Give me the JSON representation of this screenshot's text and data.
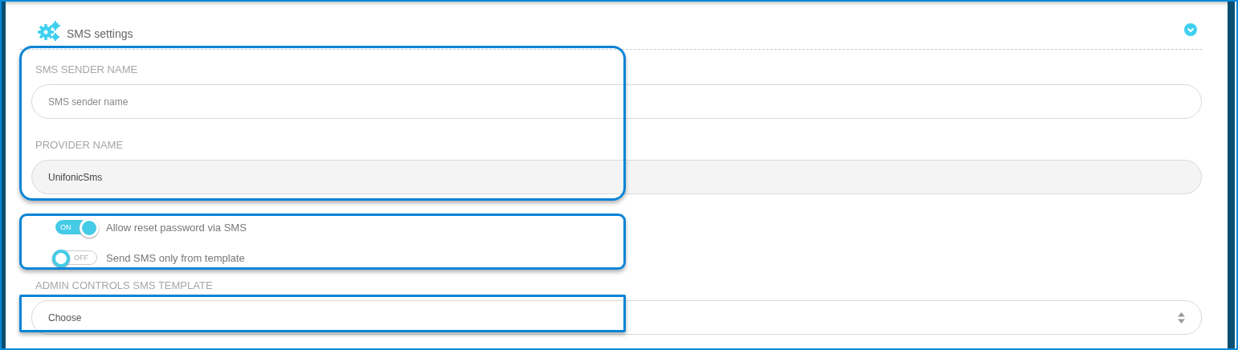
{
  "panel": {
    "title": "SMS settings",
    "expanded": true
  },
  "fields": [
    {
      "label": "SMS SENDER NAME",
      "placeholder": "SMS sender name"
    },
    {
      "label": "PROVIDER NAME",
      "value": "UnifonicSms",
      "readonly": true
    }
  ],
  "toggles": [
    {
      "label": "Allow reset password via SMS",
      "on": true,
      "state_text": "ON"
    },
    {
      "label": "Send SMS only from template",
      "on": false,
      "state_text": "OFF"
    }
  ],
  "template": {
    "label": "ADMIN CONTROLS SMS TEMPLATE",
    "value": "Choose"
  },
  "highlights": [
    {
      "kind": "rounded"
    },
    {
      "kind": "soft"
    },
    {
      "kind": "square"
    }
  ]
}
